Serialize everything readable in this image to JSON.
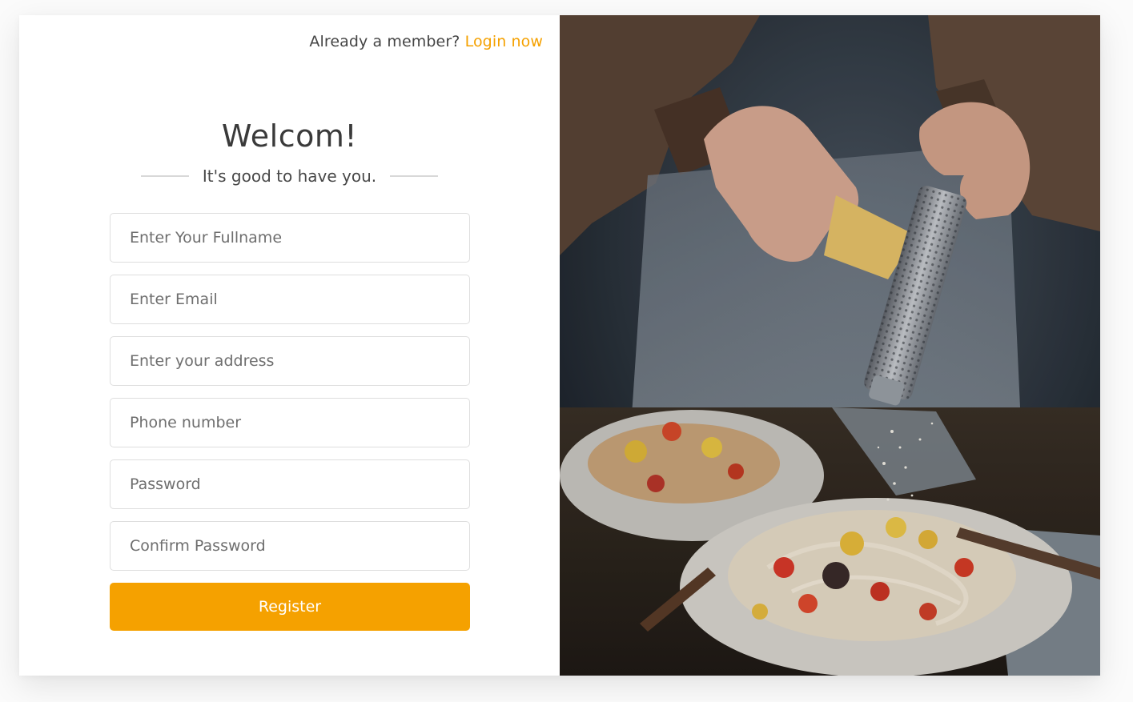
{
  "header": {
    "member_prompt": "Already a member?",
    "login_link": "Login now"
  },
  "welcome": {
    "title": "Welcom!",
    "subtitle": "It's good to have you."
  },
  "form": {
    "fields": [
      {
        "placeholder": "Enter Your Fullname",
        "value": ""
      },
      {
        "placeholder": "Enter Email",
        "value": ""
      },
      {
        "placeholder": "Enter your address",
        "value": ""
      },
      {
        "placeholder": "Phone number",
        "value": ""
      },
      {
        "placeholder": "Password",
        "value": ""
      },
      {
        "placeholder": "Confirm Password",
        "value": ""
      }
    ],
    "submit_label": "Register"
  },
  "hero_image": {
    "subject": "hands grating cheese over plates of pasta"
  },
  "colors": {
    "accent": "#f5a100",
    "text": "#454545",
    "border": "#dedede"
  }
}
